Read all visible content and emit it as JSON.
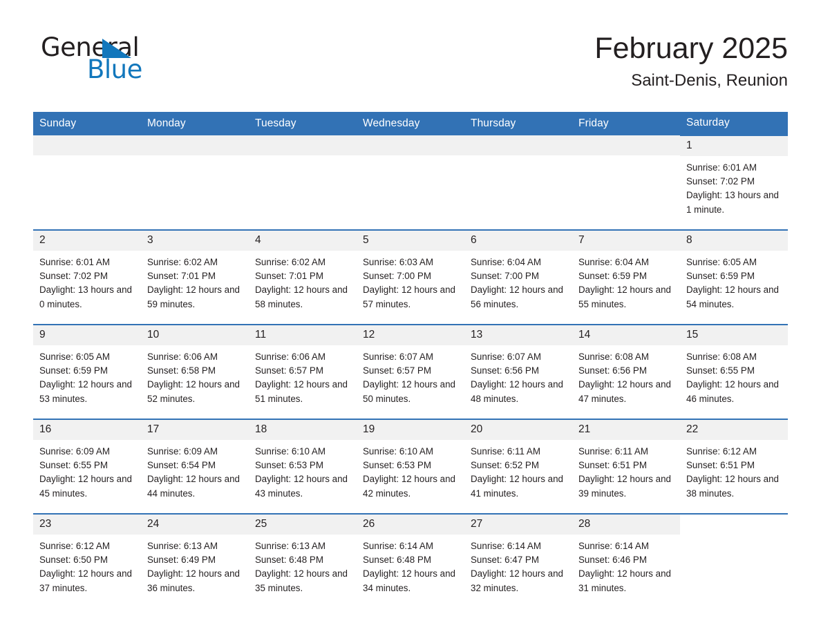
{
  "logo": {
    "word_primary": "General",
    "word_secondary": "Blue",
    "triangle_color": "#1277bc"
  },
  "header": {
    "month_title": "February 2025",
    "location": "Saint-Denis, Reunion"
  },
  "theme": {
    "header_blue": "#3272b5",
    "daynum_bg": "#f1f1f1",
    "text": "#231f20"
  },
  "calendar": {
    "weekday_headers": [
      "Sunday",
      "Monday",
      "Tuesday",
      "Wednesday",
      "Thursday",
      "Friday",
      "Saturday"
    ],
    "labels": {
      "sunrise": "Sunrise:",
      "sunset": "Sunset:",
      "daylight": "Daylight:"
    },
    "weeks": [
      [
        {
          "day": "",
          "empty": true
        },
        {
          "day": "",
          "empty": true
        },
        {
          "day": "",
          "empty": true
        },
        {
          "day": "",
          "empty": true
        },
        {
          "day": "",
          "empty": true
        },
        {
          "day": "",
          "empty": true
        },
        {
          "day": "1",
          "sunrise": "Sunrise: 6:01 AM",
          "sunset": "Sunset: 7:02 PM",
          "daylight": "Daylight: 13 hours and 1 minute."
        }
      ],
      [
        {
          "day": "2",
          "sunrise": "Sunrise: 6:01 AM",
          "sunset": "Sunset: 7:02 PM",
          "daylight": "Daylight: 13 hours and 0 minutes."
        },
        {
          "day": "3",
          "sunrise": "Sunrise: 6:02 AM",
          "sunset": "Sunset: 7:01 PM",
          "daylight": "Daylight: 12 hours and 59 minutes."
        },
        {
          "day": "4",
          "sunrise": "Sunrise: 6:02 AM",
          "sunset": "Sunset: 7:01 PM",
          "daylight": "Daylight: 12 hours and 58 minutes."
        },
        {
          "day": "5",
          "sunrise": "Sunrise: 6:03 AM",
          "sunset": "Sunset: 7:00 PM",
          "daylight": "Daylight: 12 hours and 57 minutes."
        },
        {
          "day": "6",
          "sunrise": "Sunrise: 6:04 AM",
          "sunset": "Sunset: 7:00 PM",
          "daylight": "Daylight: 12 hours and 56 minutes."
        },
        {
          "day": "7",
          "sunrise": "Sunrise: 6:04 AM",
          "sunset": "Sunset: 6:59 PM",
          "daylight": "Daylight: 12 hours and 55 minutes."
        },
        {
          "day": "8",
          "sunrise": "Sunrise: 6:05 AM",
          "sunset": "Sunset: 6:59 PM",
          "daylight": "Daylight: 12 hours and 54 minutes."
        }
      ],
      [
        {
          "day": "9",
          "sunrise": "Sunrise: 6:05 AM",
          "sunset": "Sunset: 6:59 PM",
          "daylight": "Daylight: 12 hours and 53 minutes."
        },
        {
          "day": "10",
          "sunrise": "Sunrise: 6:06 AM",
          "sunset": "Sunset: 6:58 PM",
          "daylight": "Daylight: 12 hours and 52 minutes."
        },
        {
          "day": "11",
          "sunrise": "Sunrise: 6:06 AM",
          "sunset": "Sunset: 6:57 PM",
          "daylight": "Daylight: 12 hours and 51 minutes."
        },
        {
          "day": "12",
          "sunrise": "Sunrise: 6:07 AM",
          "sunset": "Sunset: 6:57 PM",
          "daylight": "Daylight: 12 hours and 50 minutes."
        },
        {
          "day": "13",
          "sunrise": "Sunrise: 6:07 AM",
          "sunset": "Sunset: 6:56 PM",
          "daylight": "Daylight: 12 hours and 48 minutes."
        },
        {
          "day": "14",
          "sunrise": "Sunrise: 6:08 AM",
          "sunset": "Sunset: 6:56 PM",
          "daylight": "Daylight: 12 hours and 47 minutes."
        },
        {
          "day": "15",
          "sunrise": "Sunrise: 6:08 AM",
          "sunset": "Sunset: 6:55 PM",
          "daylight": "Daylight: 12 hours and 46 minutes."
        }
      ],
      [
        {
          "day": "16",
          "sunrise": "Sunrise: 6:09 AM",
          "sunset": "Sunset: 6:55 PM",
          "daylight": "Daylight: 12 hours and 45 minutes."
        },
        {
          "day": "17",
          "sunrise": "Sunrise: 6:09 AM",
          "sunset": "Sunset: 6:54 PM",
          "daylight": "Daylight: 12 hours and 44 minutes."
        },
        {
          "day": "18",
          "sunrise": "Sunrise: 6:10 AM",
          "sunset": "Sunset: 6:53 PM",
          "daylight": "Daylight: 12 hours and 43 minutes."
        },
        {
          "day": "19",
          "sunrise": "Sunrise: 6:10 AM",
          "sunset": "Sunset: 6:53 PM",
          "daylight": "Daylight: 12 hours and 42 minutes."
        },
        {
          "day": "20",
          "sunrise": "Sunrise: 6:11 AM",
          "sunset": "Sunset: 6:52 PM",
          "daylight": "Daylight: 12 hours and 41 minutes."
        },
        {
          "day": "21",
          "sunrise": "Sunrise: 6:11 AM",
          "sunset": "Sunset: 6:51 PM",
          "daylight": "Daylight: 12 hours and 39 minutes."
        },
        {
          "day": "22",
          "sunrise": "Sunrise: 6:12 AM",
          "sunset": "Sunset: 6:51 PM",
          "daylight": "Daylight: 12 hours and 38 minutes."
        }
      ],
      [
        {
          "day": "23",
          "sunrise": "Sunrise: 6:12 AM",
          "sunset": "Sunset: 6:50 PM",
          "daylight": "Daylight: 12 hours and 37 minutes."
        },
        {
          "day": "24",
          "sunrise": "Sunrise: 6:13 AM",
          "sunset": "Sunset: 6:49 PM",
          "daylight": "Daylight: 12 hours and 36 minutes."
        },
        {
          "day": "25",
          "sunrise": "Sunrise: 6:13 AM",
          "sunset": "Sunset: 6:48 PM",
          "daylight": "Daylight: 12 hours and 35 minutes."
        },
        {
          "day": "26",
          "sunrise": "Sunrise: 6:14 AM",
          "sunset": "Sunset: 6:48 PM",
          "daylight": "Daylight: 12 hours and 34 minutes."
        },
        {
          "day": "27",
          "sunrise": "Sunrise: 6:14 AM",
          "sunset": "Sunset: 6:47 PM",
          "daylight": "Daylight: 12 hours and 32 minutes."
        },
        {
          "day": "28",
          "sunrise": "Sunrise: 6:14 AM",
          "sunset": "Sunset: 6:46 PM",
          "daylight": "Daylight: 12 hours and 31 minutes."
        },
        {
          "day": "",
          "blank": true
        }
      ]
    ]
  }
}
